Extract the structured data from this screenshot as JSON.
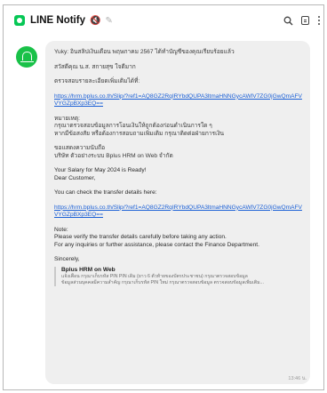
{
  "header": {
    "title": "LINE Notify",
    "mute_glyph": "🔇",
    "note_glyph": "✎",
    "icons": [
      "line-notify-app-icon",
      "mute-icon",
      "note-icon",
      "search-icon",
      "notes-icon",
      "more-icon"
    ],
    "colors": {
      "brand": "#06c755",
      "bubble": "#efefef",
      "link": "#1a5fd6"
    }
  },
  "message": {
    "th_intro": "Yuky: อินสลิปเงินเดือน พฤษภาคม 2567 ได้ทำบัญชีของคุณเรียบร้อยแล้ว",
    "th_greeting": "สวัสดีคุณ น.ส. สกายสุข ใจดีมาก",
    "th_check": "ตรวจสอบรายละเอียดเพิ่มเติมได้ที่:",
    "link1": "https://hrm.bplus.co.th/Slip/?ref1=AQ8GZ2RqIRYbdQUPA3ltmaHNNGycAWlV7ZG0jGwQmAFVVYGZpBXp3EQ==",
    "th_note_title": "หมายเหตุ:",
    "th_note_1": "กรุณาตรวจสอบข้อมูลการโอนเงินให้ถูกต้องก่อนดำเนินการใด ๆ",
    "th_note_2": "หากมีข้อสงสัย หรือต้องการสอบถามเพิ่มเติม กรุณาติดต่อฝ่ายการเงิน",
    "th_thanks": "ขอแสดงความนับถือ",
    "th_company": "บริษัท ตัวอย่างระบบ Bplus HRM on Web จำกัด",
    "en_subject": "Your Salary for May 2024 is Ready!",
    "en_greeting": "Dear Customer,",
    "en_check": "You can check the transfer details here:",
    "link2": "https://hrm.bplus.co.th/Slip/?ref1=AQ8GZ2RqIRYbdQUPA3ltmaHNNGycAWlV7ZG0jGwQmAFVVYGZpBXp3EQ==",
    "en_note_title": "Note:",
    "en_note_1": "Please verify the transfer details carefully before taking any action.",
    "en_note_2": "For any inquiries or further assistance, please contact the Finance Department.",
    "en_sincerely": "Sincerely,",
    "sig_title": "Bplus HRM on Web",
    "sig_line1": "แจ้งเตือน กรุณาเก็บรหัส PIN PIN เดิม (ยาว 6 ตัวท้ายของบัตรประชาชน) กรุณาตรวจสอบข้อมูล",
    "sig_line2": "ข้อมูลส่วนบุคคลมีความสำคัญ กรุณาเก็บรหัส PIN ใหม่ กรุณาตรวจสอบข้อมูล ตรวจสอบข้อมูลเพิ่มเติม...",
    "time": "13:46 น."
  }
}
